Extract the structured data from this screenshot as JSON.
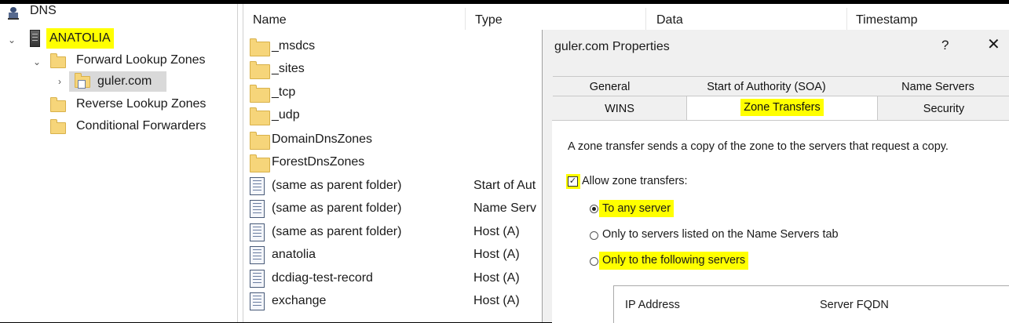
{
  "tree": {
    "root": "DNS",
    "server": "ANATOLIA",
    "forward": "Forward Lookup Zones",
    "zone": "guler.com",
    "reverse": "Reverse Lookup Zones",
    "conditional": "Conditional Forwarders"
  },
  "list": {
    "columns": [
      "Name",
      "Type",
      "Data",
      "Timestamp"
    ],
    "rows": [
      {
        "name": "_msdcs",
        "type": "",
        "icon": "folder-icon"
      },
      {
        "name": "_sites",
        "type": "",
        "icon": "folder-icon"
      },
      {
        "name": "_tcp",
        "type": "",
        "icon": "folder-icon"
      },
      {
        "name": "_udp",
        "type": "",
        "icon": "folder-icon"
      },
      {
        "name": "DomainDnsZones",
        "type": "",
        "icon": "folder-icon"
      },
      {
        "name": "ForestDnsZones",
        "type": "",
        "icon": "folder-icon"
      },
      {
        "name": "(same as parent folder)",
        "type": "Start of Aut",
        "icon": "record-icon"
      },
      {
        "name": "(same as parent folder)",
        "type": "Name Serv",
        "icon": "record-icon"
      },
      {
        "name": "(same as parent folder)",
        "type": "Host (A)",
        "icon": "record-icon"
      },
      {
        "name": "anatolia",
        "type": "Host (A)",
        "icon": "record-icon"
      },
      {
        "name": "dcdiag-test-record",
        "type": "Host (A)",
        "icon": "record-icon"
      },
      {
        "name": "exchange",
        "type": "Host (A)",
        "icon": "record-icon"
      }
    ]
  },
  "dialog": {
    "title": "guler.com Properties",
    "help": "?",
    "close": "✕",
    "tabs_top": [
      "General",
      "Start of Authority (SOA)",
      "Name Servers"
    ],
    "tabs_bottom": [
      "WINS",
      "Zone Transfers",
      "Security"
    ],
    "description": "A zone transfer sends a copy of the zone to the servers that request a copy.",
    "allow_label": "Allow zone transfers:",
    "allow_checked": true,
    "options": [
      "To any server",
      "Only to servers listed on the Name Servers tab",
      "Only to the following servers"
    ],
    "selected_option": 0,
    "table_columns": [
      "IP Address",
      "Server FQDN"
    ]
  },
  "colors": {
    "highlight": "#ffff00",
    "folder": "#f6d57a"
  }
}
